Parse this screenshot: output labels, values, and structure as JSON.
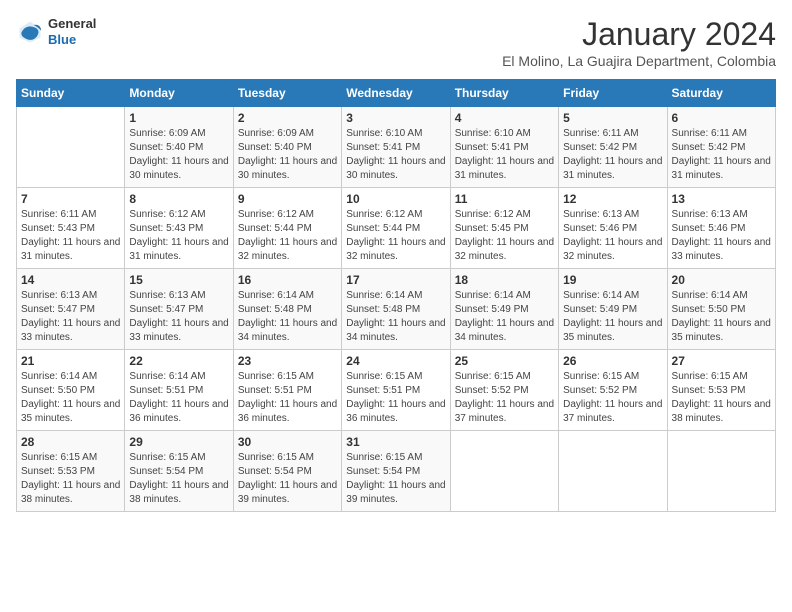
{
  "header": {
    "logo_general": "General",
    "logo_blue": "Blue",
    "month_title": "January 2024",
    "subtitle": "El Molino, La Guajira Department, Colombia"
  },
  "days_of_week": [
    "Sunday",
    "Monday",
    "Tuesday",
    "Wednesday",
    "Thursday",
    "Friday",
    "Saturday"
  ],
  "weeks": [
    [
      {
        "day": "",
        "info": ""
      },
      {
        "day": "1",
        "info": "Sunrise: 6:09 AM\nSunset: 5:40 PM\nDaylight: 11 hours and 30 minutes."
      },
      {
        "day": "2",
        "info": "Sunrise: 6:09 AM\nSunset: 5:40 PM\nDaylight: 11 hours and 30 minutes."
      },
      {
        "day": "3",
        "info": "Sunrise: 6:10 AM\nSunset: 5:41 PM\nDaylight: 11 hours and 30 minutes."
      },
      {
        "day": "4",
        "info": "Sunrise: 6:10 AM\nSunset: 5:41 PM\nDaylight: 11 hours and 31 minutes."
      },
      {
        "day": "5",
        "info": "Sunrise: 6:11 AM\nSunset: 5:42 PM\nDaylight: 11 hours and 31 minutes."
      },
      {
        "day": "6",
        "info": "Sunrise: 6:11 AM\nSunset: 5:42 PM\nDaylight: 11 hours and 31 minutes."
      }
    ],
    [
      {
        "day": "7",
        "info": "Sunrise: 6:11 AM\nSunset: 5:43 PM\nDaylight: 11 hours and 31 minutes."
      },
      {
        "day": "8",
        "info": "Sunrise: 6:12 AM\nSunset: 5:43 PM\nDaylight: 11 hours and 31 minutes."
      },
      {
        "day": "9",
        "info": "Sunrise: 6:12 AM\nSunset: 5:44 PM\nDaylight: 11 hours and 32 minutes."
      },
      {
        "day": "10",
        "info": "Sunrise: 6:12 AM\nSunset: 5:44 PM\nDaylight: 11 hours and 32 minutes."
      },
      {
        "day": "11",
        "info": "Sunrise: 6:12 AM\nSunset: 5:45 PM\nDaylight: 11 hours and 32 minutes."
      },
      {
        "day": "12",
        "info": "Sunrise: 6:13 AM\nSunset: 5:46 PM\nDaylight: 11 hours and 32 minutes."
      },
      {
        "day": "13",
        "info": "Sunrise: 6:13 AM\nSunset: 5:46 PM\nDaylight: 11 hours and 33 minutes."
      }
    ],
    [
      {
        "day": "14",
        "info": "Sunrise: 6:13 AM\nSunset: 5:47 PM\nDaylight: 11 hours and 33 minutes."
      },
      {
        "day": "15",
        "info": "Sunrise: 6:13 AM\nSunset: 5:47 PM\nDaylight: 11 hours and 33 minutes."
      },
      {
        "day": "16",
        "info": "Sunrise: 6:14 AM\nSunset: 5:48 PM\nDaylight: 11 hours and 34 minutes."
      },
      {
        "day": "17",
        "info": "Sunrise: 6:14 AM\nSunset: 5:48 PM\nDaylight: 11 hours and 34 minutes."
      },
      {
        "day": "18",
        "info": "Sunrise: 6:14 AM\nSunset: 5:49 PM\nDaylight: 11 hours and 34 minutes."
      },
      {
        "day": "19",
        "info": "Sunrise: 6:14 AM\nSunset: 5:49 PM\nDaylight: 11 hours and 35 minutes."
      },
      {
        "day": "20",
        "info": "Sunrise: 6:14 AM\nSunset: 5:50 PM\nDaylight: 11 hours and 35 minutes."
      }
    ],
    [
      {
        "day": "21",
        "info": "Sunrise: 6:14 AM\nSunset: 5:50 PM\nDaylight: 11 hours and 35 minutes."
      },
      {
        "day": "22",
        "info": "Sunrise: 6:14 AM\nSunset: 5:51 PM\nDaylight: 11 hours and 36 minutes."
      },
      {
        "day": "23",
        "info": "Sunrise: 6:15 AM\nSunset: 5:51 PM\nDaylight: 11 hours and 36 minutes."
      },
      {
        "day": "24",
        "info": "Sunrise: 6:15 AM\nSunset: 5:51 PM\nDaylight: 11 hours and 36 minutes."
      },
      {
        "day": "25",
        "info": "Sunrise: 6:15 AM\nSunset: 5:52 PM\nDaylight: 11 hours and 37 minutes."
      },
      {
        "day": "26",
        "info": "Sunrise: 6:15 AM\nSunset: 5:52 PM\nDaylight: 11 hours and 37 minutes."
      },
      {
        "day": "27",
        "info": "Sunrise: 6:15 AM\nSunset: 5:53 PM\nDaylight: 11 hours and 38 minutes."
      }
    ],
    [
      {
        "day": "28",
        "info": "Sunrise: 6:15 AM\nSunset: 5:53 PM\nDaylight: 11 hours and 38 minutes."
      },
      {
        "day": "29",
        "info": "Sunrise: 6:15 AM\nSunset: 5:54 PM\nDaylight: 11 hours and 38 minutes."
      },
      {
        "day": "30",
        "info": "Sunrise: 6:15 AM\nSunset: 5:54 PM\nDaylight: 11 hours and 39 minutes."
      },
      {
        "day": "31",
        "info": "Sunrise: 6:15 AM\nSunset: 5:54 PM\nDaylight: 11 hours and 39 minutes."
      },
      {
        "day": "",
        "info": ""
      },
      {
        "day": "",
        "info": ""
      },
      {
        "day": "",
        "info": ""
      }
    ]
  ]
}
